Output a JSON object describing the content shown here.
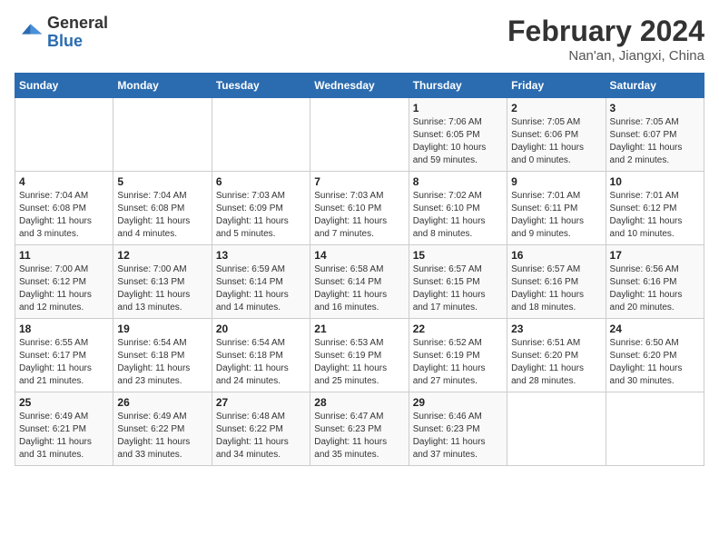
{
  "logo": {
    "text_general": "General",
    "text_blue": "Blue"
  },
  "title": "February 2024",
  "subtitle": "Nan'an, Jiangxi, China",
  "weekdays": [
    "Sunday",
    "Monday",
    "Tuesday",
    "Wednesday",
    "Thursday",
    "Friday",
    "Saturday"
  ],
  "weeks": [
    [
      {
        "day": "",
        "info": ""
      },
      {
        "day": "",
        "info": ""
      },
      {
        "day": "",
        "info": ""
      },
      {
        "day": "",
        "info": ""
      },
      {
        "day": "1",
        "info": "Sunrise: 7:06 AM\nSunset: 6:05 PM\nDaylight: 10 hours\nand 59 minutes."
      },
      {
        "day": "2",
        "info": "Sunrise: 7:05 AM\nSunset: 6:06 PM\nDaylight: 11 hours\nand 0 minutes."
      },
      {
        "day": "3",
        "info": "Sunrise: 7:05 AM\nSunset: 6:07 PM\nDaylight: 11 hours\nand 2 minutes."
      }
    ],
    [
      {
        "day": "4",
        "info": "Sunrise: 7:04 AM\nSunset: 6:08 PM\nDaylight: 11 hours\nand 3 minutes."
      },
      {
        "day": "5",
        "info": "Sunrise: 7:04 AM\nSunset: 6:08 PM\nDaylight: 11 hours\nand 4 minutes."
      },
      {
        "day": "6",
        "info": "Sunrise: 7:03 AM\nSunset: 6:09 PM\nDaylight: 11 hours\nand 5 minutes."
      },
      {
        "day": "7",
        "info": "Sunrise: 7:03 AM\nSunset: 6:10 PM\nDaylight: 11 hours\nand 7 minutes."
      },
      {
        "day": "8",
        "info": "Sunrise: 7:02 AM\nSunset: 6:10 PM\nDaylight: 11 hours\nand 8 minutes."
      },
      {
        "day": "9",
        "info": "Sunrise: 7:01 AM\nSunset: 6:11 PM\nDaylight: 11 hours\nand 9 minutes."
      },
      {
        "day": "10",
        "info": "Sunrise: 7:01 AM\nSunset: 6:12 PM\nDaylight: 11 hours\nand 10 minutes."
      }
    ],
    [
      {
        "day": "11",
        "info": "Sunrise: 7:00 AM\nSunset: 6:12 PM\nDaylight: 11 hours\nand 12 minutes."
      },
      {
        "day": "12",
        "info": "Sunrise: 7:00 AM\nSunset: 6:13 PM\nDaylight: 11 hours\nand 13 minutes."
      },
      {
        "day": "13",
        "info": "Sunrise: 6:59 AM\nSunset: 6:14 PM\nDaylight: 11 hours\nand 14 minutes."
      },
      {
        "day": "14",
        "info": "Sunrise: 6:58 AM\nSunset: 6:14 PM\nDaylight: 11 hours\nand 16 minutes."
      },
      {
        "day": "15",
        "info": "Sunrise: 6:57 AM\nSunset: 6:15 PM\nDaylight: 11 hours\nand 17 minutes."
      },
      {
        "day": "16",
        "info": "Sunrise: 6:57 AM\nSunset: 6:16 PM\nDaylight: 11 hours\nand 18 minutes."
      },
      {
        "day": "17",
        "info": "Sunrise: 6:56 AM\nSunset: 6:16 PM\nDaylight: 11 hours\nand 20 minutes."
      }
    ],
    [
      {
        "day": "18",
        "info": "Sunrise: 6:55 AM\nSunset: 6:17 PM\nDaylight: 11 hours\nand 21 minutes."
      },
      {
        "day": "19",
        "info": "Sunrise: 6:54 AM\nSunset: 6:18 PM\nDaylight: 11 hours\nand 23 minutes."
      },
      {
        "day": "20",
        "info": "Sunrise: 6:54 AM\nSunset: 6:18 PM\nDaylight: 11 hours\nand 24 minutes."
      },
      {
        "day": "21",
        "info": "Sunrise: 6:53 AM\nSunset: 6:19 PM\nDaylight: 11 hours\nand 25 minutes."
      },
      {
        "day": "22",
        "info": "Sunrise: 6:52 AM\nSunset: 6:19 PM\nDaylight: 11 hours\nand 27 minutes."
      },
      {
        "day": "23",
        "info": "Sunrise: 6:51 AM\nSunset: 6:20 PM\nDaylight: 11 hours\nand 28 minutes."
      },
      {
        "day": "24",
        "info": "Sunrise: 6:50 AM\nSunset: 6:20 PM\nDaylight: 11 hours\nand 30 minutes."
      }
    ],
    [
      {
        "day": "25",
        "info": "Sunrise: 6:49 AM\nSunset: 6:21 PM\nDaylight: 11 hours\nand 31 minutes."
      },
      {
        "day": "26",
        "info": "Sunrise: 6:49 AM\nSunset: 6:22 PM\nDaylight: 11 hours\nand 33 minutes."
      },
      {
        "day": "27",
        "info": "Sunrise: 6:48 AM\nSunset: 6:22 PM\nDaylight: 11 hours\nand 34 minutes."
      },
      {
        "day": "28",
        "info": "Sunrise: 6:47 AM\nSunset: 6:23 PM\nDaylight: 11 hours\nand 35 minutes."
      },
      {
        "day": "29",
        "info": "Sunrise: 6:46 AM\nSunset: 6:23 PM\nDaylight: 11 hours\nand 37 minutes."
      },
      {
        "day": "",
        "info": ""
      },
      {
        "day": "",
        "info": ""
      }
    ]
  ]
}
